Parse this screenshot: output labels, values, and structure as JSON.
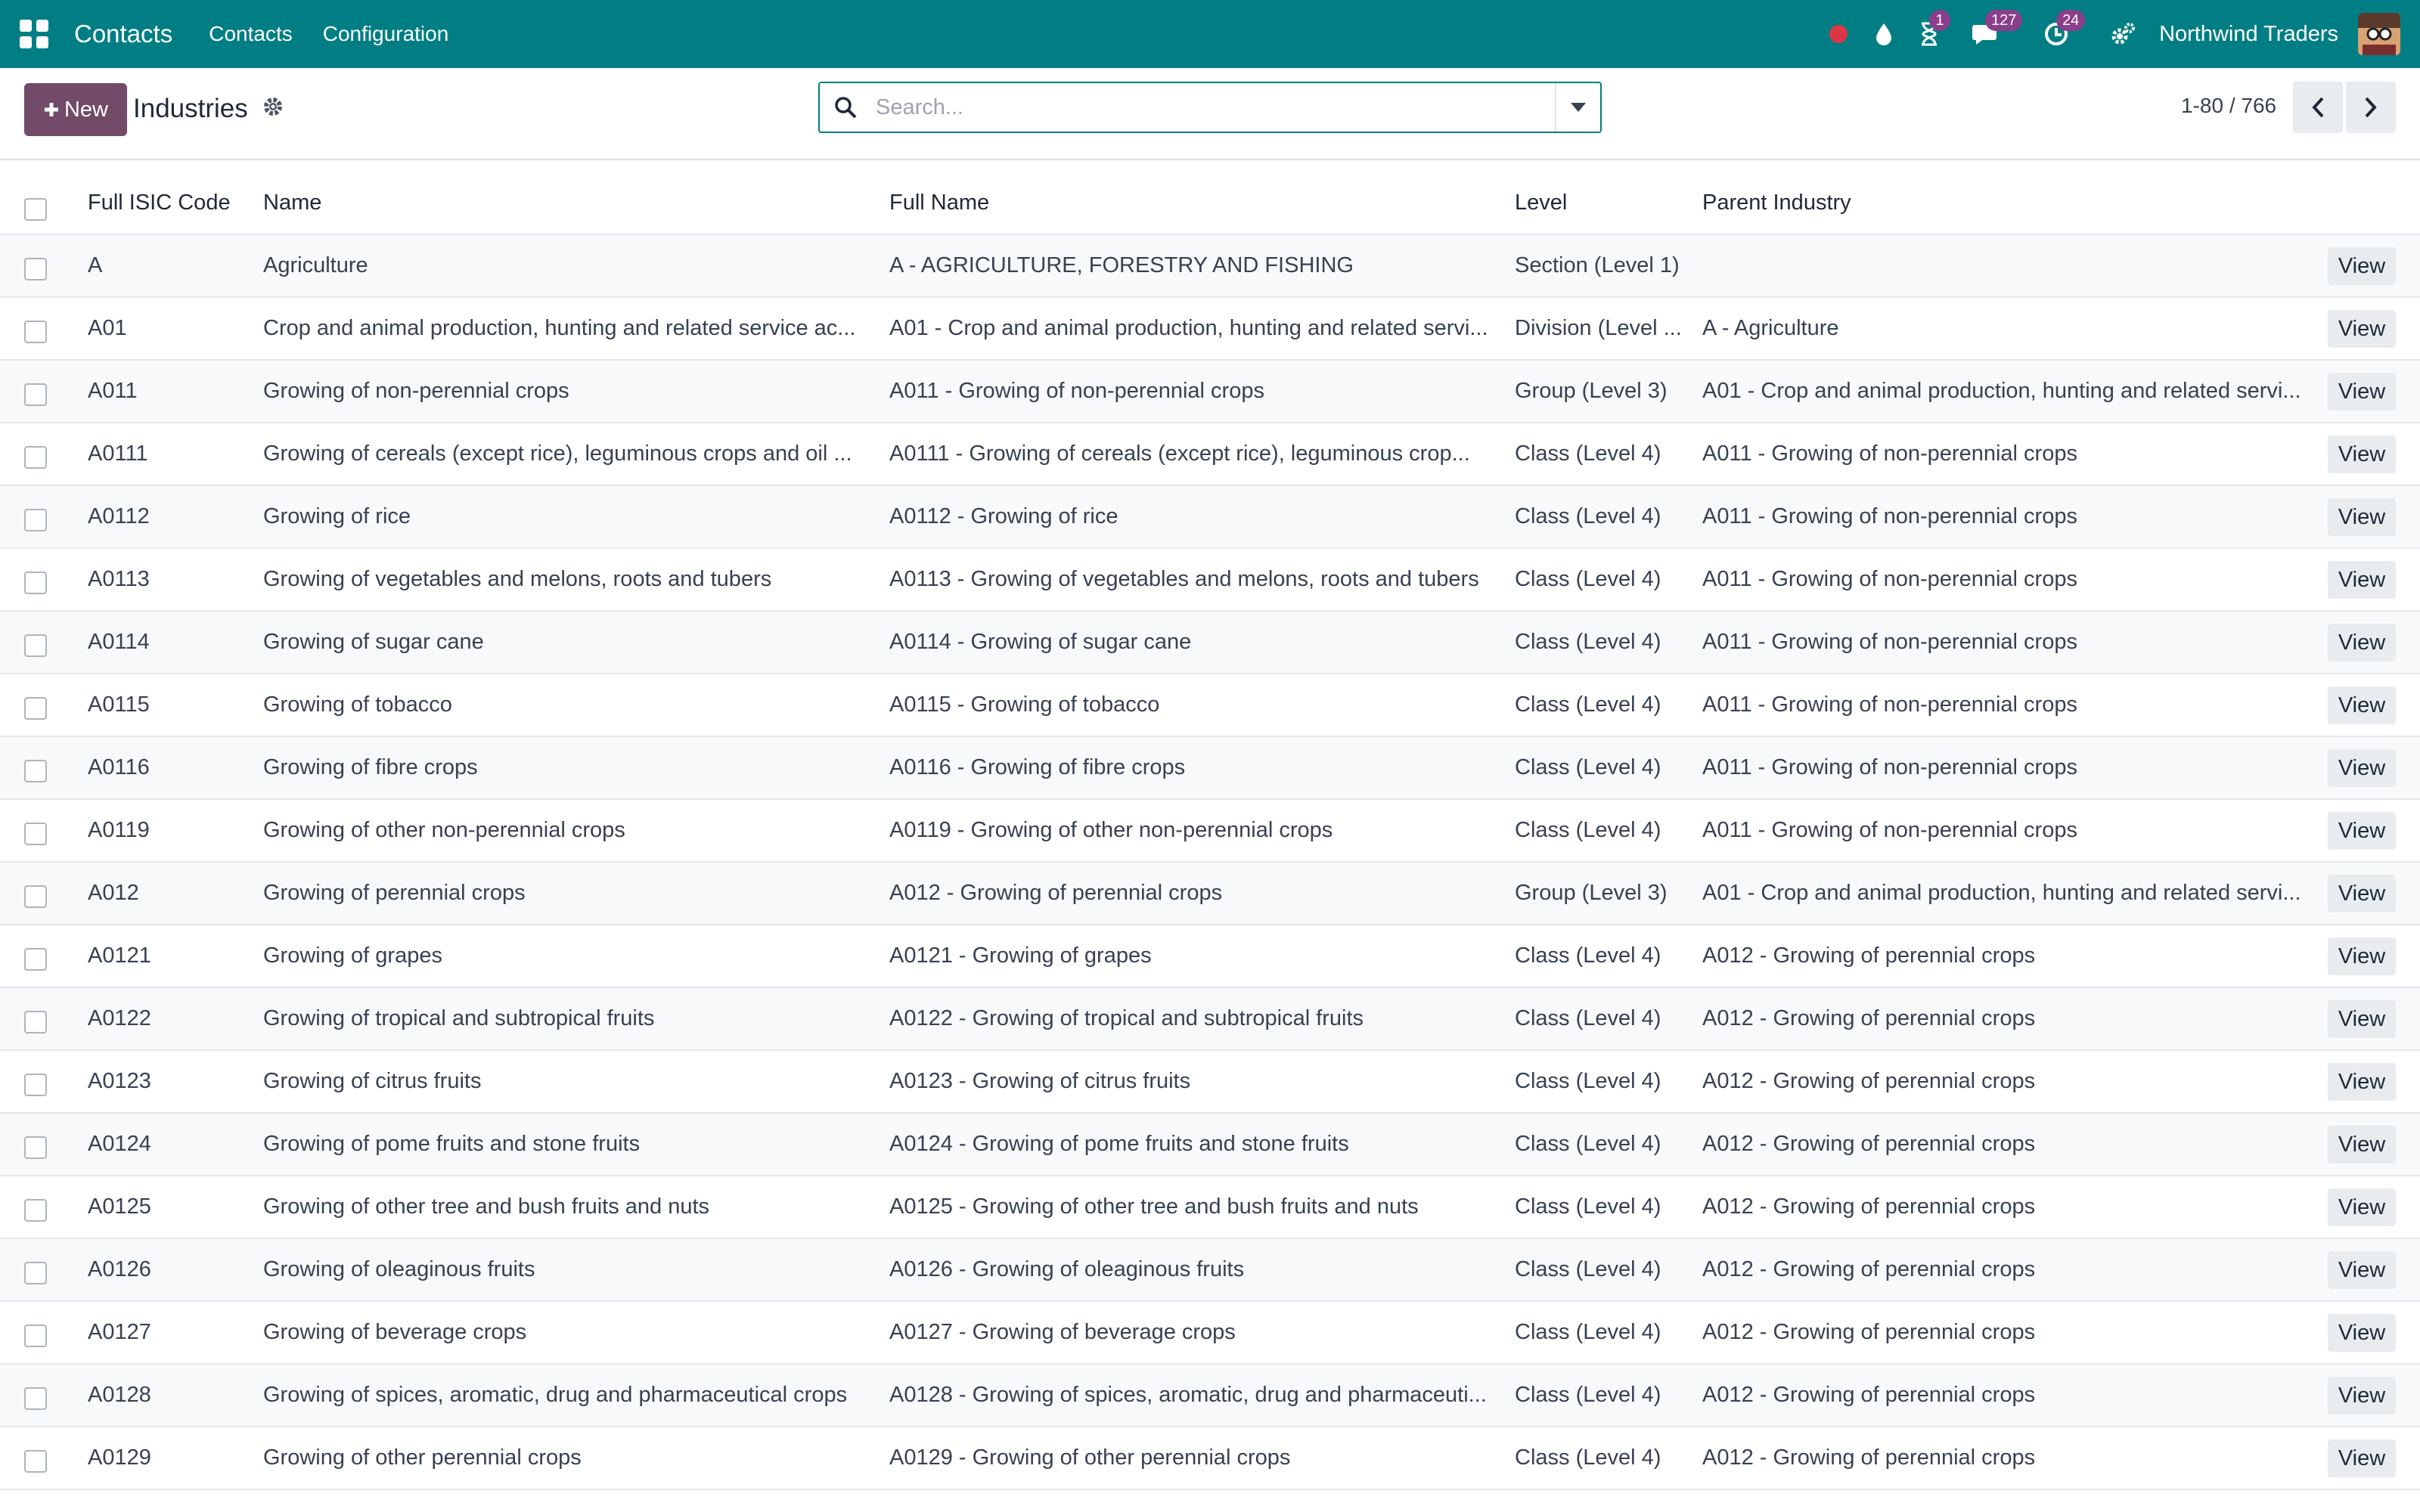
{
  "navbar": {
    "brand": "Contacts",
    "menu": [
      "Contacts",
      "Configuration"
    ],
    "badges": {
      "activities": "1",
      "messages": "127",
      "timer": "24"
    },
    "company": "Northwind Traders"
  },
  "control_panel": {
    "new_label": "New",
    "title": "Industries",
    "search_placeholder": "Search...",
    "pager": "1-80 / 766"
  },
  "columns": [
    "Full ISIC Code",
    "Name",
    "Full Name",
    "Level",
    "Parent Industry"
  ],
  "view_label": "View",
  "rows": [
    {
      "code": "A",
      "name": "Agriculture",
      "full_name": "A - AGRICULTURE, FORESTRY AND FISHING",
      "level": "Section (Level 1)",
      "parent": ""
    },
    {
      "code": "A01",
      "name": "Crop and animal production, hunting and related service ac...",
      "full_name": "A01 - Crop and animal production, hunting and related servi...",
      "level": "Division (Level ...",
      "parent": "A - Agriculture"
    },
    {
      "code": "A011",
      "name": "Growing of non-perennial crops",
      "full_name": "A011 - Growing of non-perennial crops",
      "level": "Group (Level 3)",
      "parent": "A01 - Crop and animal production, hunting and related servi..."
    },
    {
      "code": "A0111",
      "name": "Growing of cereals (except rice), leguminous crops and oil ...",
      "full_name": "A0111 - Growing of cereals (except rice), leguminous crop...",
      "level": "Class (Level 4)",
      "parent": "A011 - Growing of non-perennial crops"
    },
    {
      "code": "A0112",
      "name": "Growing of rice",
      "full_name": "A0112 - Growing of rice",
      "level": "Class (Level 4)",
      "parent": "A011 - Growing of non-perennial crops"
    },
    {
      "code": "A0113",
      "name": "Growing of vegetables and melons, roots and tubers",
      "full_name": "A0113 - Growing of vegetables and melons, roots and tubers",
      "level": "Class (Level 4)",
      "parent": "A011 - Growing of non-perennial crops"
    },
    {
      "code": "A0114",
      "name": "Growing of sugar cane",
      "full_name": "A0114 - Growing of sugar cane",
      "level": "Class (Level 4)",
      "parent": "A011 - Growing of non-perennial crops"
    },
    {
      "code": "A0115",
      "name": "Growing of tobacco",
      "full_name": "A0115 - Growing of tobacco",
      "level": "Class (Level 4)",
      "parent": "A011 - Growing of non-perennial crops"
    },
    {
      "code": "A0116",
      "name": "Growing of fibre crops",
      "full_name": "A0116 - Growing of fibre crops",
      "level": "Class (Level 4)",
      "parent": "A011 - Growing of non-perennial crops"
    },
    {
      "code": "A0119",
      "name": "Growing of other non-perennial crops",
      "full_name": "A0119 - Growing of other non-perennial crops",
      "level": "Class (Level 4)",
      "parent": "A011 - Growing of non-perennial crops"
    },
    {
      "code": "A012",
      "name": "Growing of perennial crops",
      "full_name": "A012 - Growing of perennial crops",
      "level": "Group (Level 3)",
      "parent": "A01 - Crop and animal production, hunting and related servi..."
    },
    {
      "code": "A0121",
      "name": "Growing of grapes",
      "full_name": "A0121 - Growing of grapes",
      "level": "Class (Level 4)",
      "parent": "A012 - Growing of perennial crops"
    },
    {
      "code": "A0122",
      "name": "Growing of tropical and subtropical fruits",
      "full_name": "A0122 - Growing of tropical and subtropical fruits",
      "level": "Class (Level 4)",
      "parent": "A012 - Growing of perennial crops"
    },
    {
      "code": "A0123",
      "name": "Growing of citrus fruits",
      "full_name": "A0123 - Growing of citrus fruits",
      "level": "Class (Level 4)",
      "parent": "A012 - Growing of perennial crops"
    },
    {
      "code": "A0124",
      "name": "Growing of pome fruits and stone fruits",
      "full_name": "A0124 - Growing of pome fruits and stone fruits",
      "level": "Class (Level 4)",
      "parent": "A012 - Growing of perennial crops"
    },
    {
      "code": "A0125",
      "name": "Growing of other tree and bush fruits and nuts",
      "full_name": "A0125 - Growing of other tree and bush fruits and nuts",
      "level": "Class (Level 4)",
      "parent": "A012 - Growing of perennial crops"
    },
    {
      "code": "A0126",
      "name": "Growing of oleaginous fruits",
      "full_name": "A0126 - Growing of oleaginous fruits",
      "level": "Class (Level 4)",
      "parent": "A012 - Growing of perennial crops"
    },
    {
      "code": "A0127",
      "name": "Growing of beverage crops",
      "full_name": "A0127 - Growing of beverage crops",
      "level": "Class (Level 4)",
      "parent": "A012 - Growing of perennial crops"
    },
    {
      "code": "A0128",
      "name": "Growing of spices, aromatic, drug and pharmaceutical crops",
      "full_name": "A0128 - Growing of spices, aromatic, drug and pharmaceuti...",
      "level": "Class (Level 4)",
      "parent": "A012 - Growing of perennial crops"
    },
    {
      "code": "A0129",
      "name": "Growing of other perennial crops",
      "full_name": "A0129 - Growing of other perennial crops",
      "level": "Class (Level 4)",
      "parent": "A012 - Growing of perennial crops"
    }
  ]
}
